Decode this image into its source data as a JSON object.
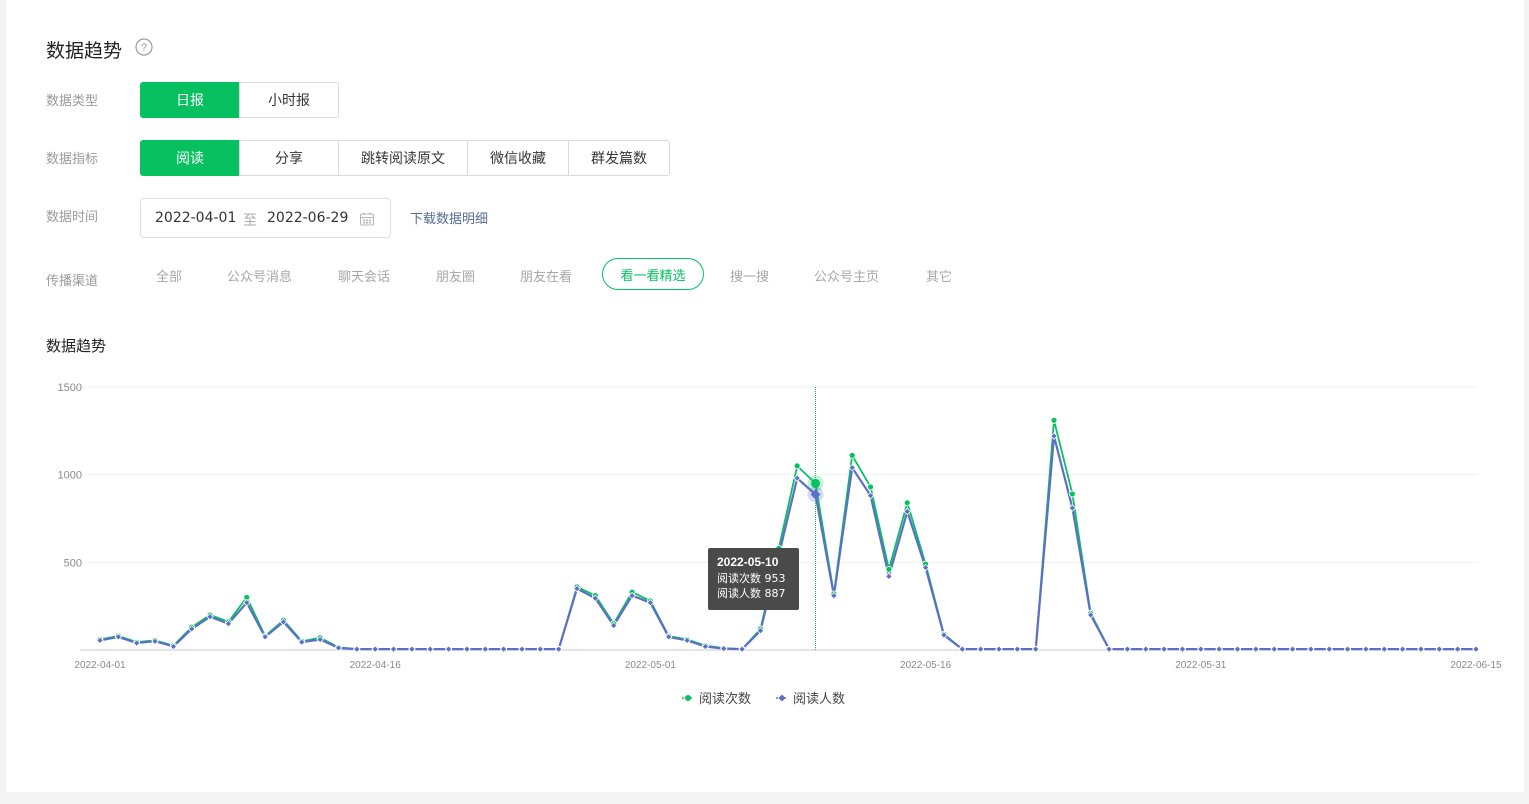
{
  "page": {
    "title": "数据趋势",
    "section_title": "数据趋势"
  },
  "filters": {
    "type_label": "数据类型",
    "type_options": [
      "日报",
      "小时报"
    ],
    "type_selected": "日报",
    "metric_label": "数据指标",
    "metric_options": [
      "阅读",
      "分享",
      "跳转阅读原文",
      "微信收藏",
      "群发篇数"
    ],
    "metric_selected": "阅读",
    "time_label": "数据时间",
    "date_start": "2022-04-01",
    "date_sep": "至",
    "date_end": "2022-06-29",
    "download_link": "下载数据明细",
    "channel_label": "传播渠道",
    "channels": [
      "全部",
      "公众号消息",
      "聊天会话",
      "朋友圈",
      "朋友在看",
      "看一看精选",
      "搜一搜",
      "公众号主页",
      "其它"
    ],
    "channel_selected": "看一看精选"
  },
  "tooltip": {
    "date": "2022-05-10",
    "line1": "阅读次数 953",
    "line2": "阅读人数 887"
  },
  "colors": {
    "accent": "#07c160",
    "series1": "#07c160",
    "series2": "#5b6fc7",
    "link": "#576b95",
    "tooltip_bg": "#4a4a4a"
  },
  "icons": {
    "help": "question-circle-icon",
    "calendar": "calendar-icon"
  },
  "chart_data": {
    "type": "line",
    "x_start": "2022-04-01",
    "x_end": "2022-06-15",
    "xtick_labels": [
      "2022-04-01",
      "2022-04-16",
      "2022-05-01",
      "2022-05-16",
      "2022-05-31",
      "2022-06-15"
    ],
    "ytick_labels": [
      "500",
      "1000",
      "1500"
    ],
    "ylim": [
      0,
      1500
    ],
    "legend": "bottom-center",
    "grid": true,
    "highlight_date": "2022-05-10",
    "series": [
      {
        "name": "阅读次数",
        "values": [
          60,
          80,
          45,
          55,
          25,
          130,
          200,
          160,
          300,
          80,
          170,
          50,
          70,
          15,
          5,
          5,
          5,
          5,
          5,
          5,
          5,
          5,
          5,
          5,
          5,
          5,
          360,
          310,
          150,
          330,
          280,
          80,
          60,
          25,
          10,
          5,
          120,
          580,
          1050,
          950,
          320,
          1110,
          930,
          460,
          840,
          490,
          90,
          5,
          5,
          5,
          5,
          5,
          1310,
          890,
          210,
          5,
          5,
          5,
          5,
          5,
          5,
          5,
          5,
          5,
          5,
          5,
          5,
          5,
          5,
          5,
          5,
          5,
          5,
          5,
          5,
          5
        ]
      },
      {
        "name": "阅读人数",
        "values": [
          55,
          75,
          40,
          50,
          20,
          120,
          190,
          150,
          270,
          75,
          160,
          45,
          60,
          12,
          5,
          5,
          5,
          5,
          5,
          5,
          5,
          5,
          5,
          5,
          5,
          5,
          350,
          295,
          140,
          310,
          270,
          75,
          55,
          20,
          8,
          5,
          110,
          540,
          980,
          887,
          310,
          1040,
          880,
          420,
          790,
          470,
          85,
          5,
          5,
          5,
          5,
          5,
          1220,
          810,
          200,
          5,
          5,
          5,
          5,
          5,
          5,
          5,
          5,
          5,
          5,
          5,
          5,
          5,
          5,
          5,
          5,
          5,
          5,
          5,
          5,
          5
        ]
      }
    ]
  }
}
